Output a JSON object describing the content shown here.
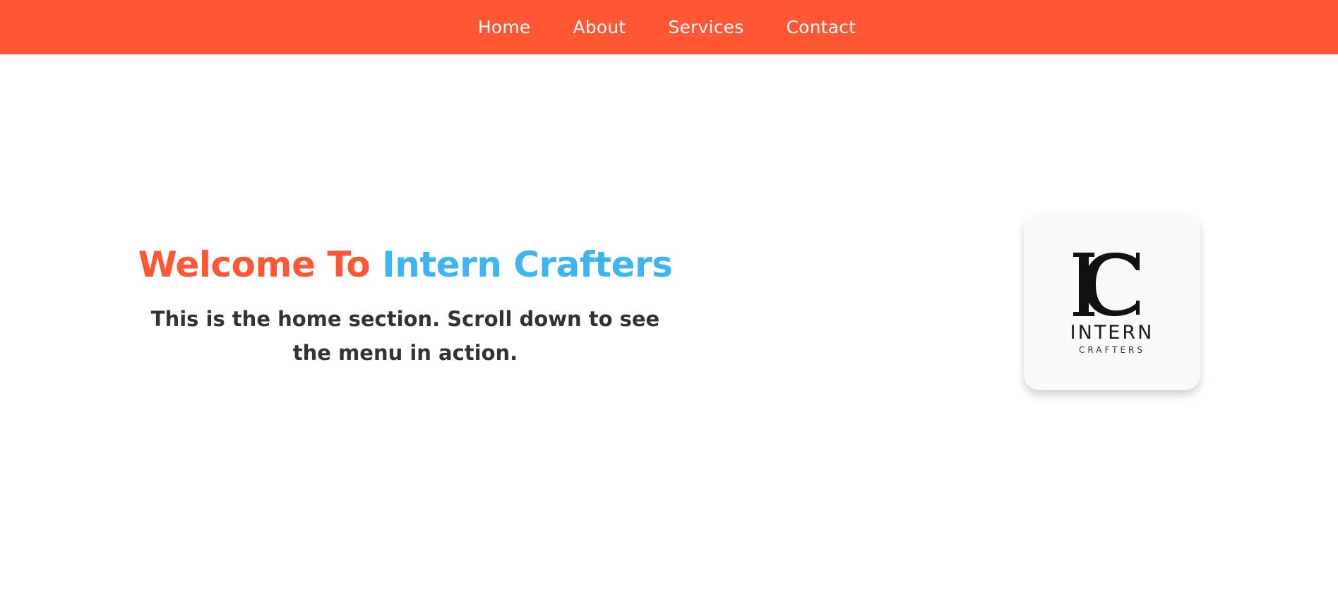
{
  "nav": {
    "items": [
      {
        "label": "Home"
      },
      {
        "label": "About"
      },
      {
        "label": "Services"
      },
      {
        "label": "Contact"
      }
    ]
  },
  "hero": {
    "title_part1": "Welcome To",
    "title_part2": "Intern Crafters",
    "subtitle": "This is the home section. Scroll down to see the menu in action."
  },
  "logo": {
    "monogram": "IC",
    "name": "INTERN",
    "tagline": "CRAFTERS"
  },
  "colors": {
    "accent": "#ff5733",
    "secondary": "#3db5f0",
    "text": "#333333"
  }
}
